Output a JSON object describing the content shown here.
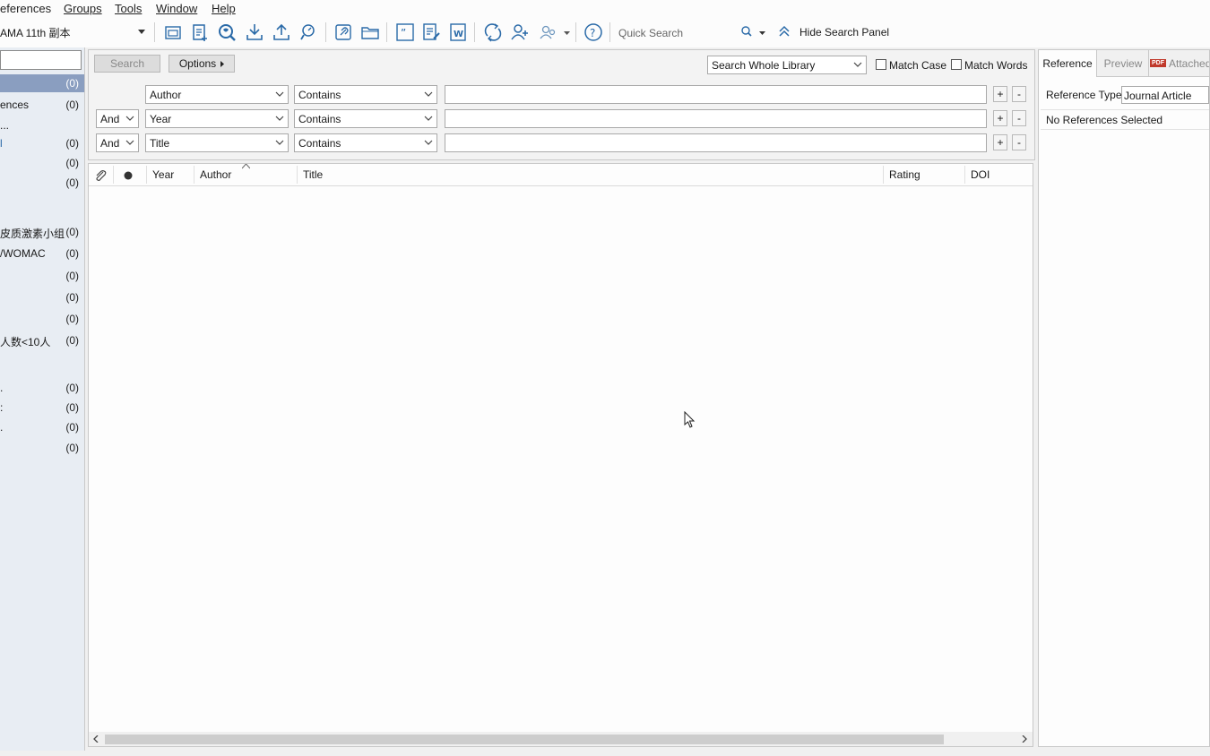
{
  "menubar": {
    "items": [
      {
        "label": "eferences"
      },
      {
        "label": "Groups"
      },
      {
        "label": "Tools"
      },
      {
        "label": "Window"
      },
      {
        "label": "Help"
      }
    ]
  },
  "toolbar": {
    "style_value": "AMA 11th 副本",
    "quick_search_placeholder": "Quick Search",
    "hide_search_panel_label": "Hide Search Panel",
    "accent_color": "#2a6aa8"
  },
  "groups": [
    {
      "name": "",
      "count": "(0)",
      "selected": true
    },
    {
      "name": "ences",
      "count": "(0)"
    },
    {
      "name": "...",
      "count": ""
    },
    {
      "name": "l",
      "count": "(0)"
    },
    {
      "name": "",
      "count": "(0)"
    },
    {
      "name": "",
      "count": "(0)"
    },
    {
      "name": "皮质激素小组",
      "count": "(0)"
    },
    {
      "name": "/WOMAC",
      "count": "(0)"
    },
    {
      "name": "",
      "count": "(0)"
    },
    {
      "name": "",
      "count": "(0)"
    },
    {
      "name": "",
      "count": "(0)"
    },
    {
      "name": "人数<10人",
      "count": "(0)"
    },
    {
      "name": ".",
      "count": "(0)"
    },
    {
      "name": ":",
      "count": "(0)"
    },
    {
      "name": ".",
      "count": "(0)"
    },
    {
      "name": "",
      "count": "(0)"
    }
  ],
  "search": {
    "search_button": "Search",
    "options_button": "Options",
    "scope_value": "Search Whole Library",
    "match_case_label": "Match Case",
    "match_words_label": "Match Words",
    "rows": [
      {
        "connector": "",
        "field": "Author",
        "operator": "Contains",
        "value": ""
      },
      {
        "connector": "And",
        "field": "Year",
        "operator": "Contains",
        "value": ""
      },
      {
        "connector": "And",
        "field": "Title",
        "operator": "Contains",
        "value": ""
      }
    ],
    "plus": "+",
    "minus": "-"
  },
  "ref_list": {
    "columns": [
      "Year",
      "Author",
      "Title",
      "Rating",
      "DOI"
    ]
  },
  "right_panel": {
    "tabs": [
      "Reference",
      "Preview",
      "Attached"
    ],
    "pdf_badge": "PDF",
    "ref_type_label": "Reference Type:",
    "ref_type_value": "Journal Article",
    "no_selection_text": "No References Selected"
  }
}
